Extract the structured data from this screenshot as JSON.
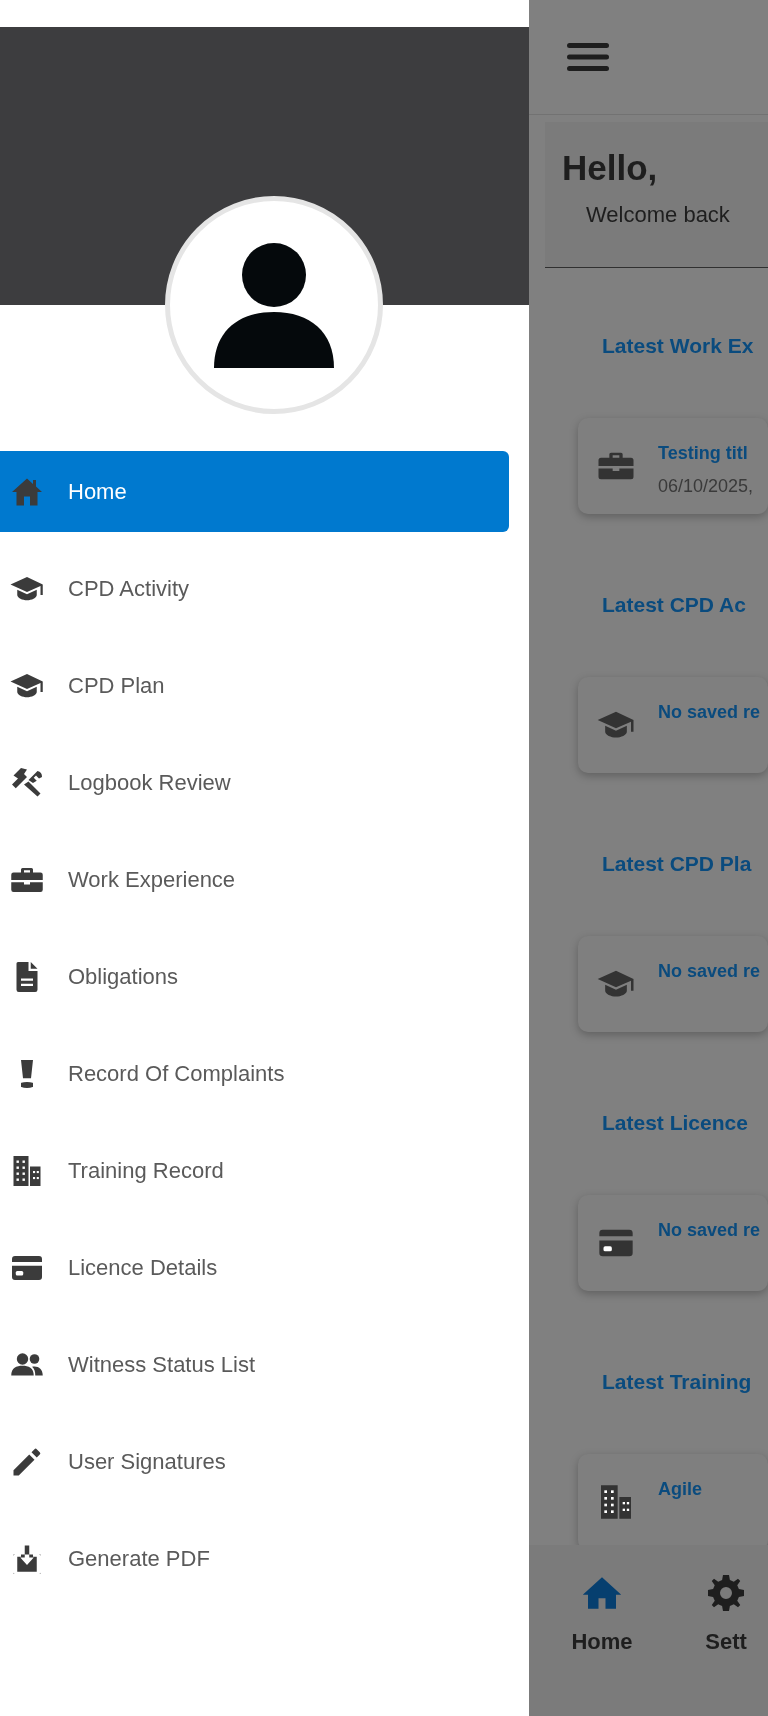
{
  "drawer": {
    "items": [
      {
        "label": "Home",
        "selected": true
      },
      {
        "label": "CPD Activity",
        "selected": false
      },
      {
        "label": "CPD Plan",
        "selected": false
      },
      {
        "label": "Logbook Review",
        "selected": false
      },
      {
        "label": "Work Experience",
        "selected": false
      },
      {
        "label": "Obligations",
        "selected": false
      },
      {
        "label": "Record Of Complaints",
        "selected": false
      },
      {
        "label": "Training Record",
        "selected": false
      },
      {
        "label": "Licence Details",
        "selected": false
      },
      {
        "label": "Witness Status List",
        "selected": false
      },
      {
        "label": "User Signatures",
        "selected": false
      },
      {
        "label": "Generate PDF",
        "selected": false
      }
    ]
  },
  "main": {
    "greeting": "Hello,",
    "subtitle": "Welcome back",
    "sections": [
      {
        "heading": "Latest Work Ex",
        "card": {
          "title": "Testing titl",
          "date": "06/10/2025,"
        }
      },
      {
        "heading": "Latest CPD Ac",
        "card": {
          "title": "No saved re"
        }
      },
      {
        "heading": "Latest CPD Pla",
        "card": {
          "title": "No saved re"
        }
      },
      {
        "heading": "Latest Licence",
        "card": {
          "title": "No saved re"
        }
      },
      {
        "heading": "Latest Training",
        "card": {
          "title": "Agile"
        }
      }
    ]
  },
  "bottom_nav": [
    {
      "label": "Home",
      "selected": true
    },
    {
      "label": "Sett",
      "selected": false
    }
  ]
}
